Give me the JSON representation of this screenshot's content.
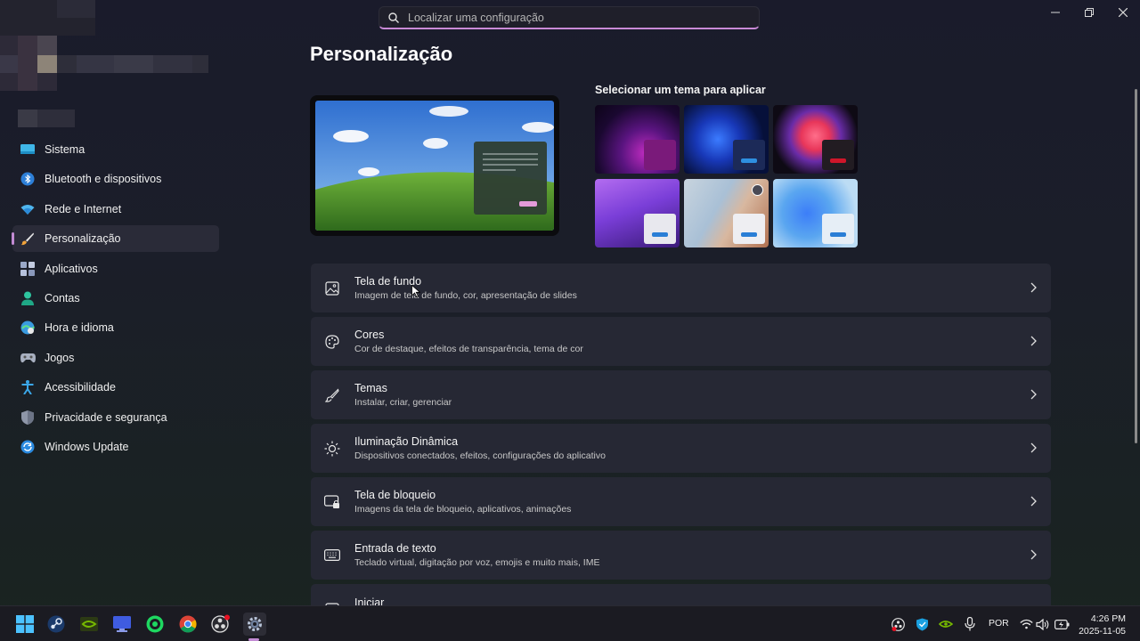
{
  "window": {
    "minimize_glyph": "—",
    "maximize_glyph": "❐",
    "close_glyph": "✕"
  },
  "search": {
    "placeholder": "Localizar uma configuração",
    "value": ""
  },
  "sidebar": {
    "items": [
      {
        "label": "Sistema",
        "icon": "system-icon",
        "active": false
      },
      {
        "label": "Bluetooth e dispositivos",
        "icon": "bluetooth-icon",
        "active": false
      },
      {
        "label": "Rede e Internet",
        "icon": "wifi-icon",
        "active": false
      },
      {
        "label": "Personalização",
        "icon": "brush-icon",
        "active": true
      },
      {
        "label": "Aplicativos",
        "icon": "apps-icon",
        "active": false
      },
      {
        "label": "Contas",
        "icon": "account-icon",
        "active": false
      },
      {
        "label": "Hora e idioma",
        "icon": "time-language-icon",
        "active": false
      },
      {
        "label": "Jogos",
        "icon": "gamepad-icon",
        "active": false
      },
      {
        "label": "Acessibilidade",
        "icon": "accessibility-icon",
        "active": false
      },
      {
        "label": "Privacidade e segurança",
        "icon": "shield-icon",
        "active": false
      },
      {
        "label": "Windows Update",
        "icon": "update-icon",
        "active": false
      }
    ]
  },
  "main": {
    "title": "Personalização",
    "theme_section_label": "Selecionar um tema para aplicar",
    "settings": [
      {
        "title": "Tela de fundo",
        "subtitle": "Imagem de tela de fundo, cor, apresentação de slides",
        "icon": "image-icon"
      },
      {
        "title": "Cores",
        "subtitle": "Cor de destaque, efeitos de transparência, tema de cor",
        "icon": "palette-icon"
      },
      {
        "title": "Temas",
        "subtitle": "Instalar, criar, gerenciar",
        "icon": "brush-icon"
      },
      {
        "title": "Iluminação Dinâmica",
        "subtitle": "Dispositivos conectados, efeitos, configurações do aplicativo",
        "icon": "sun-icon"
      },
      {
        "title": "Tela de bloqueio",
        "subtitle": "Imagens da tela de bloqueio, aplicativos, animações",
        "icon": "lock-screen-icon"
      },
      {
        "title": "Entrada de texto",
        "subtitle": "Teclado virtual, digitação por voz, emojis e muito mais, IME",
        "icon": "keyboard-icon"
      },
      {
        "title": "Iniciar",
        "subtitle": "",
        "icon": "start-icon"
      }
    ]
  },
  "taskbar": {
    "language": "POR",
    "time": "4:26 PM",
    "date": "2025-11-05"
  }
}
